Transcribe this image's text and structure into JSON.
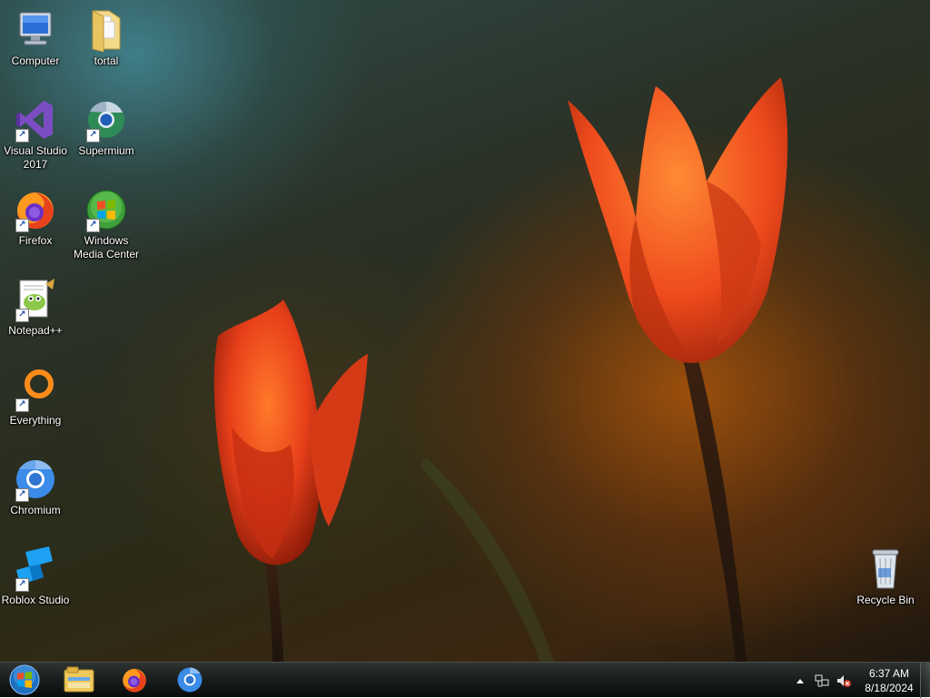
{
  "desktop": {
    "icons": [
      {
        "label": "Computer",
        "icon": "computer-icon",
        "shortcut": false
      },
      {
        "label": "tortal",
        "icon": "folder-icon",
        "shortcut": false
      },
      {
        "label": "Visual Studio\n2017",
        "icon": "visual-studio-icon",
        "shortcut": true
      },
      {
        "label": "Supermium",
        "icon": "supermium-icon",
        "shortcut": true
      },
      {
        "label": "Firefox",
        "icon": "firefox-icon",
        "shortcut": true
      },
      {
        "label": "Windows\nMedia Center",
        "icon": "media-center-icon",
        "shortcut": true
      },
      {
        "label": "Notepad++",
        "icon": "notepadpp-icon",
        "shortcut": true
      },
      {
        "label": "Everything",
        "icon": "everything-icon",
        "shortcut": true
      },
      {
        "label": "Chromium",
        "icon": "chromium-icon",
        "shortcut": true
      },
      {
        "label": "Roblox Studio",
        "icon": "roblox-studio-icon",
        "shortcut": true
      },
      {
        "label": "Recycle Bin",
        "icon": "recycle-bin-icon",
        "shortcut": false
      }
    ],
    "shortcut_arrow": "↗"
  },
  "taskbar": {
    "pinned": [
      {
        "name": "start-button",
        "icon": "windows-orb-icon"
      },
      {
        "name": "file-explorer-button",
        "icon": "file-explorer-icon"
      },
      {
        "name": "firefox-taskbar-button",
        "icon": "firefox-icon"
      },
      {
        "name": "chromium-taskbar-button",
        "icon": "chromium-icon"
      }
    ],
    "tray": {
      "icons": [
        "show-hidden-icons-icon",
        "network-icon",
        "volume-muted-icon"
      ],
      "time": "6:37 AM",
      "date": "8/18/2024"
    }
  },
  "colors": {
    "taskbar": "#1a1e1e",
    "label_text": "#ffffff",
    "tulip": "#e8401a"
  }
}
